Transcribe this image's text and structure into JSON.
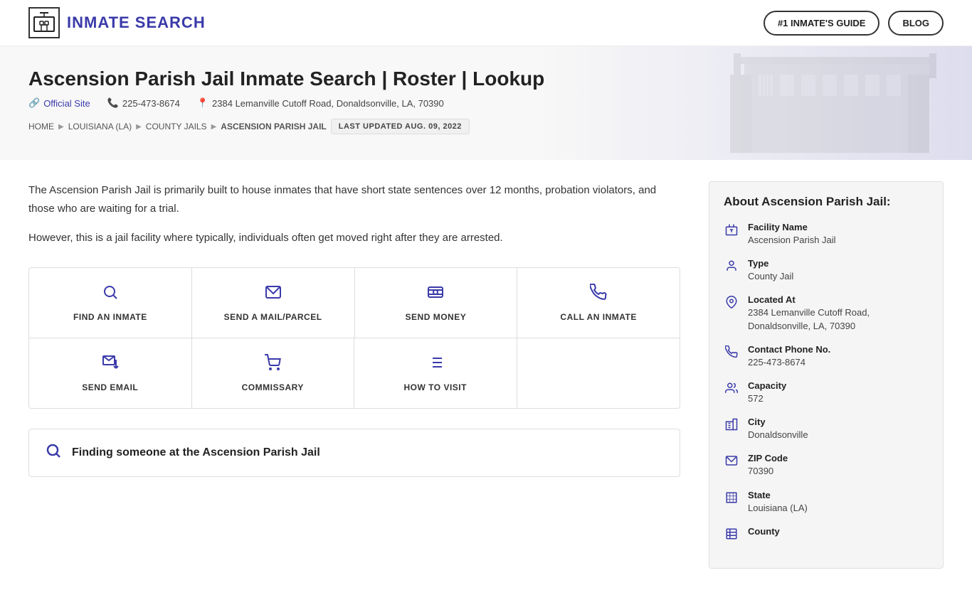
{
  "header": {
    "logo_icon": "🏛",
    "logo_text": "INMATE SEARCH",
    "nav": [
      {
        "label": "#1 INMATE'S GUIDE",
        "id": "inmates-guide"
      },
      {
        "label": "BLOG",
        "id": "blog"
      }
    ]
  },
  "hero": {
    "title": "Ascension Parish Jail Inmate Search | Roster | Lookup",
    "official_site_label": "Official Site",
    "phone": "225-473-8674",
    "address": "2384 Lemanville Cutoff Road, Donaldsonville, LA, 70390",
    "breadcrumb": [
      {
        "label": "HOME",
        "href": "#"
      },
      {
        "label": "LOUISIANA (LA)",
        "href": "#"
      },
      {
        "label": "COUNTY JAILS",
        "href": "#"
      },
      {
        "label": "ASCENSION PARISH JAIL",
        "href": "#",
        "current": true
      }
    ],
    "last_updated": "LAST UPDATED AUG. 09, 2022"
  },
  "main": {
    "description_p1": "The Ascension Parish Jail is primarily built to house inmates that have short state sentences over 12 months, probation violators, and those who are waiting for a trial.",
    "description_p2": "However, this is a jail facility where typically, individuals often get moved right after they are arrested.",
    "actions": [
      [
        {
          "icon": "🔍",
          "label": "FIND AN INMATE",
          "id": "find-inmate"
        },
        {
          "icon": "✉",
          "label": "SEND A MAIL/PARCEL",
          "id": "send-mail"
        },
        {
          "icon": "💵",
          "label": "SEND MONEY",
          "id": "send-money"
        },
        {
          "icon": "📞",
          "label": "CALL AN INMATE",
          "id": "call-inmate"
        }
      ],
      [
        {
          "icon": "💬",
          "label": "SEND EMAIL",
          "id": "send-email"
        },
        {
          "icon": "🛒",
          "label": "COMMISSARY",
          "id": "commissary"
        },
        {
          "icon": "📋",
          "label": "HOW TO VISIT",
          "id": "how-to-visit"
        }
      ]
    ],
    "finding_title": "Finding someone at the Ascension Parish Jail"
  },
  "sidebar": {
    "about_title": "About Ascension Parish Jail:",
    "items": [
      {
        "icon": "🏢",
        "label": "Facility Name",
        "value": "Ascension Parish Jail",
        "id": "facility-name"
      },
      {
        "icon": "👤",
        "label": "Type",
        "value": "County Jail",
        "id": "type"
      },
      {
        "icon": "📍",
        "label": "Located At",
        "value": "2384 Lemanville Cutoff Road, Donaldsonville, LA, 70390",
        "id": "located-at"
      },
      {
        "icon": "📞",
        "label": "Contact Phone No.",
        "value": "225-473-8674",
        "id": "phone"
      },
      {
        "icon": "👥",
        "label": "Capacity",
        "value": "572",
        "id": "capacity"
      },
      {
        "icon": "🏙",
        "label": "City",
        "value": "Donaldsonville",
        "id": "city"
      },
      {
        "icon": "✉",
        "label": "ZIP Code",
        "value": "70390",
        "id": "zip"
      },
      {
        "icon": "🗺",
        "label": "State",
        "value": "Louisiana (LA)",
        "id": "state"
      },
      {
        "icon": "📋",
        "label": "County",
        "value": "",
        "id": "county"
      }
    ]
  }
}
